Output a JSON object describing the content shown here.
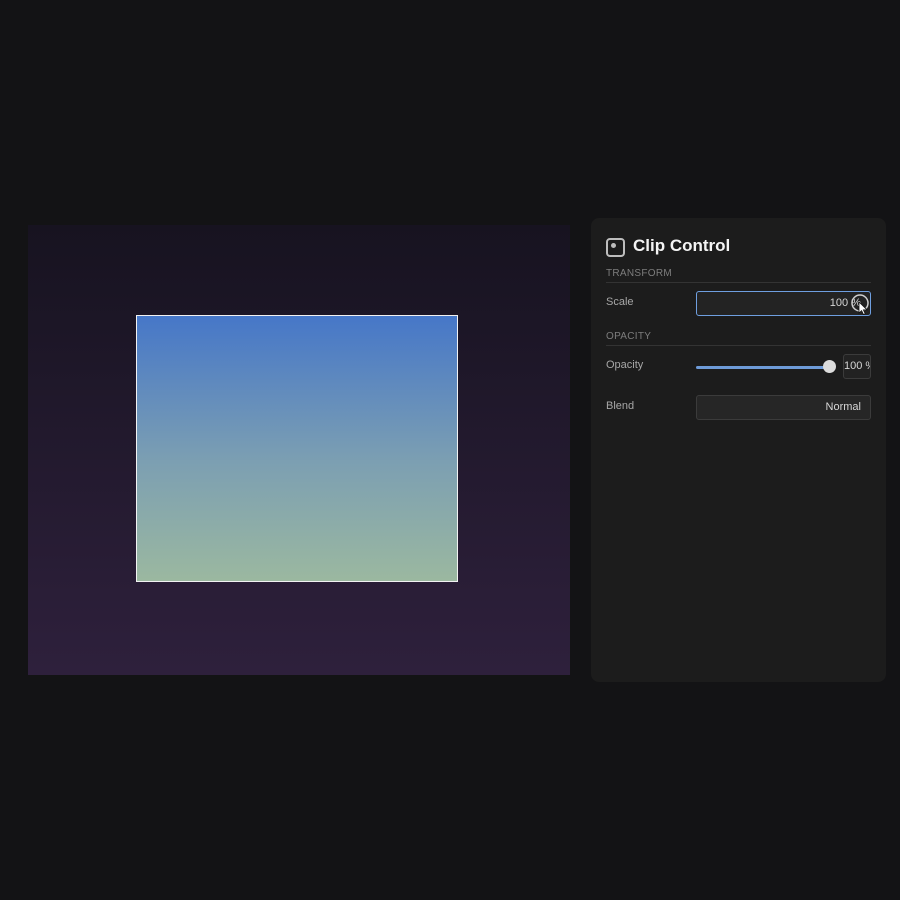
{
  "panel": {
    "title": "Clip Control",
    "icon": "clip-icon"
  },
  "transform": {
    "section_label": "TRANSFORM",
    "scale_label": "Scale",
    "scale_value": "100 %"
  },
  "opacity": {
    "section_label": "OPACITY",
    "opacity_label": "Opacity",
    "opacity_value": "100 %",
    "opacity_level": 1.0,
    "blend_label": "Blend",
    "blend_value": "Normal"
  },
  "colors": {
    "accent": "#6f9fe0",
    "panel_bg": "#1c1c1c",
    "page_bg": "#131315"
  }
}
